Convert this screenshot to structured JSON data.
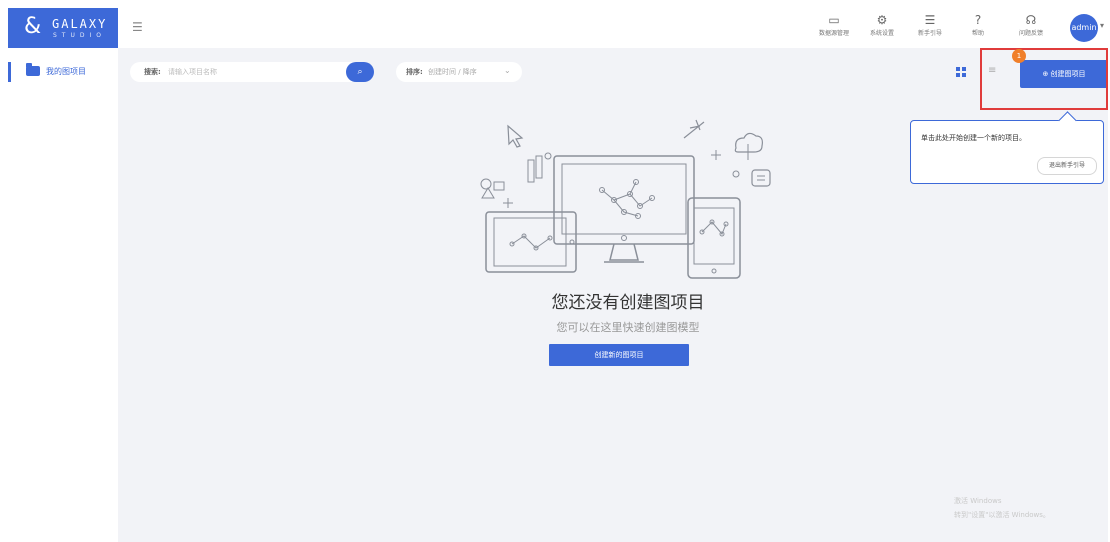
{
  "header": {
    "logo_mark": "&",
    "logo_title": "GALAXY",
    "logo_sub": "STUDIO",
    "tools": [
      {
        "label": "数据源管理",
        "icon": "database-icon"
      },
      {
        "label": "系统设置",
        "icon": "settings-icon"
      },
      {
        "label": "新手引导",
        "icon": "guide-icon"
      },
      {
        "label": "帮助",
        "icon": "help-icon"
      },
      {
        "label": "问题反馈",
        "icon": "feedback-icon"
      }
    ],
    "user": "admin"
  },
  "sidebar": {
    "items": [
      {
        "label": "我的图项目",
        "icon": "folder-icon"
      }
    ]
  },
  "toolbar": {
    "search_label": "搜索:",
    "search_placeholder": "请输入项目名称",
    "sort_label": "排序:",
    "sort_value": "创建时间 / 降序",
    "create_button": "创建图项目"
  },
  "guide": {
    "step": "1",
    "message": "单击此处开始创建一个新的项目。",
    "exit_button": "退出新手引导"
  },
  "empty": {
    "title": "您还没有创建图项目",
    "subtitle": "您可以在这里快速创建图模型",
    "button": "创建新的图项目"
  },
  "watermark": {
    "line1": "激活 Windows",
    "line2": "转到\"设置\"以激活 Windows。"
  },
  "colors": {
    "primary": "#3d69d8",
    "highlight": "#e03b3b",
    "step": "#f07f2a",
    "background": "#f2f3f7"
  }
}
